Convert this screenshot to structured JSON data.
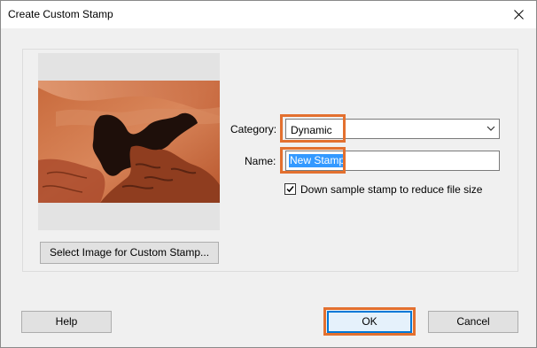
{
  "window": {
    "title": "Create Custom Stamp",
    "close_icon": "close-icon"
  },
  "preview": {
    "image_description_icon": "stamp-preview-image",
    "select_button_label": "Select Image for Custom Stamp..."
  },
  "form": {
    "category_label": "Category:",
    "category_value": "Dynamic",
    "name_label": "Name:",
    "name_value": "New Stamp",
    "downsample_label": "Down sample stamp to reduce file size",
    "downsample_checked": true
  },
  "footer": {
    "help_label": "Help",
    "ok_label": "OK",
    "cancel_label": "Cancel"
  },
  "colors": {
    "highlight": "#e3702f",
    "selection": "#3399ff",
    "default_button_border": "#0078d7"
  }
}
